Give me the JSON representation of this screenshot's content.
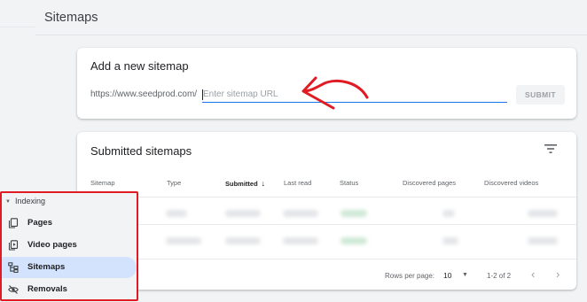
{
  "page": {
    "title": "Sitemaps"
  },
  "add_sitemap": {
    "title": "Add a new sitemap",
    "prefix": "https://www.seedprod.com/",
    "input_placeholder": "Enter sitemap URL",
    "input_value": "",
    "submit_label": "SUBMIT"
  },
  "submitted": {
    "title": "Submitted sitemaps",
    "filter_icon": "filter-list-icon",
    "columns": [
      "Sitemap",
      "Type",
      "Submitted",
      "Last read",
      "Status",
      "Discovered pages",
      "Discovered videos"
    ],
    "sorted_column": "Submitted",
    "sort_icon": "arrow-down-icon",
    "footer": {
      "rows_per_page_label": "Rows per page:",
      "rows_per_page_value": "10",
      "range": "1-2 of 2"
    }
  },
  "sidebar": {
    "section": "Indexing",
    "items": [
      {
        "label": "Pages",
        "icon": "pages-icon",
        "active": false
      },
      {
        "label": "Video pages",
        "icon": "video-pages-icon",
        "active": false
      },
      {
        "label": "Sitemaps",
        "icon": "sitemap-icon",
        "active": true
      },
      {
        "label": "Removals",
        "icon": "visibility-off-icon",
        "active": false
      }
    ]
  },
  "colors": {
    "accent": "#1a73e8",
    "highlight_border": "#e01b24",
    "active_nav": "#d3e3fd"
  }
}
